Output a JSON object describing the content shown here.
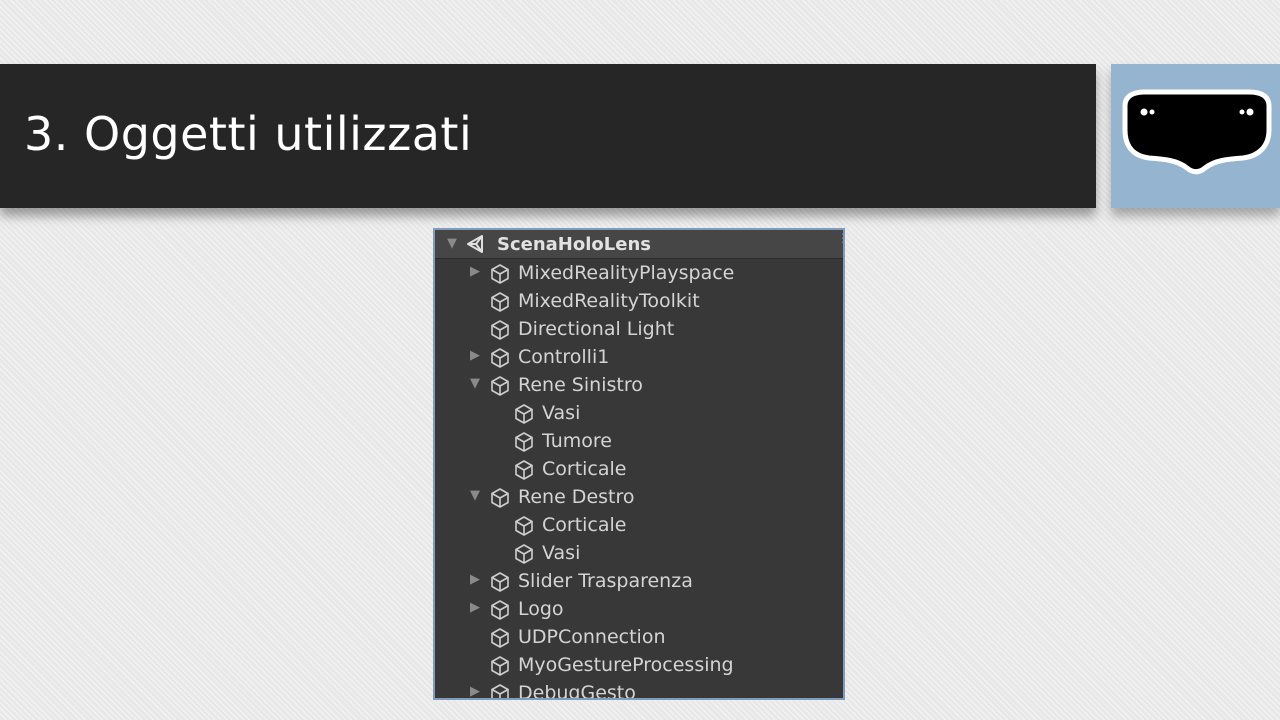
{
  "slide": {
    "title": "3. Oggetti utilizzati",
    "logo_icon": "hololens-headset-icon",
    "colors": {
      "title_bar": "#262626",
      "logo_tile": "#94b4d0",
      "panel_bg": "#383838",
      "panel_border": "#7f9dbb"
    }
  },
  "hierarchy": {
    "scene_name": "ScenaHoloLens",
    "scene_icon": "unity-logo-icon",
    "items": [
      {
        "label": "MixedRealityPlayspace",
        "depth": 0,
        "expander": "collapsed",
        "icon": "gameobject-cube-icon"
      },
      {
        "label": "MixedRealityToolkit",
        "depth": 0,
        "expander": "none",
        "icon": "gameobject-cube-icon"
      },
      {
        "label": "Directional Light",
        "depth": 0,
        "expander": "none",
        "icon": "gameobject-cube-icon"
      },
      {
        "label": "Controlli1",
        "depth": 0,
        "expander": "collapsed",
        "icon": "gameobject-cube-icon"
      },
      {
        "label": "Rene Sinistro",
        "depth": 0,
        "expander": "expanded",
        "icon": "gameobject-cube-icon"
      },
      {
        "label": "Vasi",
        "depth": 1,
        "expander": "none",
        "icon": "gameobject-cube-icon"
      },
      {
        "label": "Tumore",
        "depth": 1,
        "expander": "none",
        "icon": "gameobject-cube-icon"
      },
      {
        "label": "Corticale",
        "depth": 1,
        "expander": "none",
        "icon": "gameobject-cube-icon"
      },
      {
        "label": "Rene Destro",
        "depth": 0,
        "expander": "expanded",
        "icon": "gameobject-cube-icon"
      },
      {
        "label": "Corticale",
        "depth": 1,
        "expander": "none",
        "icon": "gameobject-cube-icon"
      },
      {
        "label": "Vasi",
        "depth": 1,
        "expander": "none",
        "icon": "gameobject-cube-icon"
      },
      {
        "label": "Slider Trasparenza",
        "depth": 0,
        "expander": "collapsed",
        "icon": "gameobject-cube-icon"
      },
      {
        "label": "Logo",
        "depth": 0,
        "expander": "collapsed",
        "icon": "gameobject-cube-icon"
      },
      {
        "label": "UDPConnection",
        "depth": 0,
        "expander": "none",
        "icon": "gameobject-cube-icon"
      },
      {
        "label": "MyoGestureProcessing",
        "depth": 0,
        "expander": "none",
        "icon": "gameobject-cube-icon"
      },
      {
        "label": "DebugGesto",
        "depth": 0,
        "expander": "collapsed",
        "icon": "gameobject-cube-icon"
      }
    ]
  }
}
